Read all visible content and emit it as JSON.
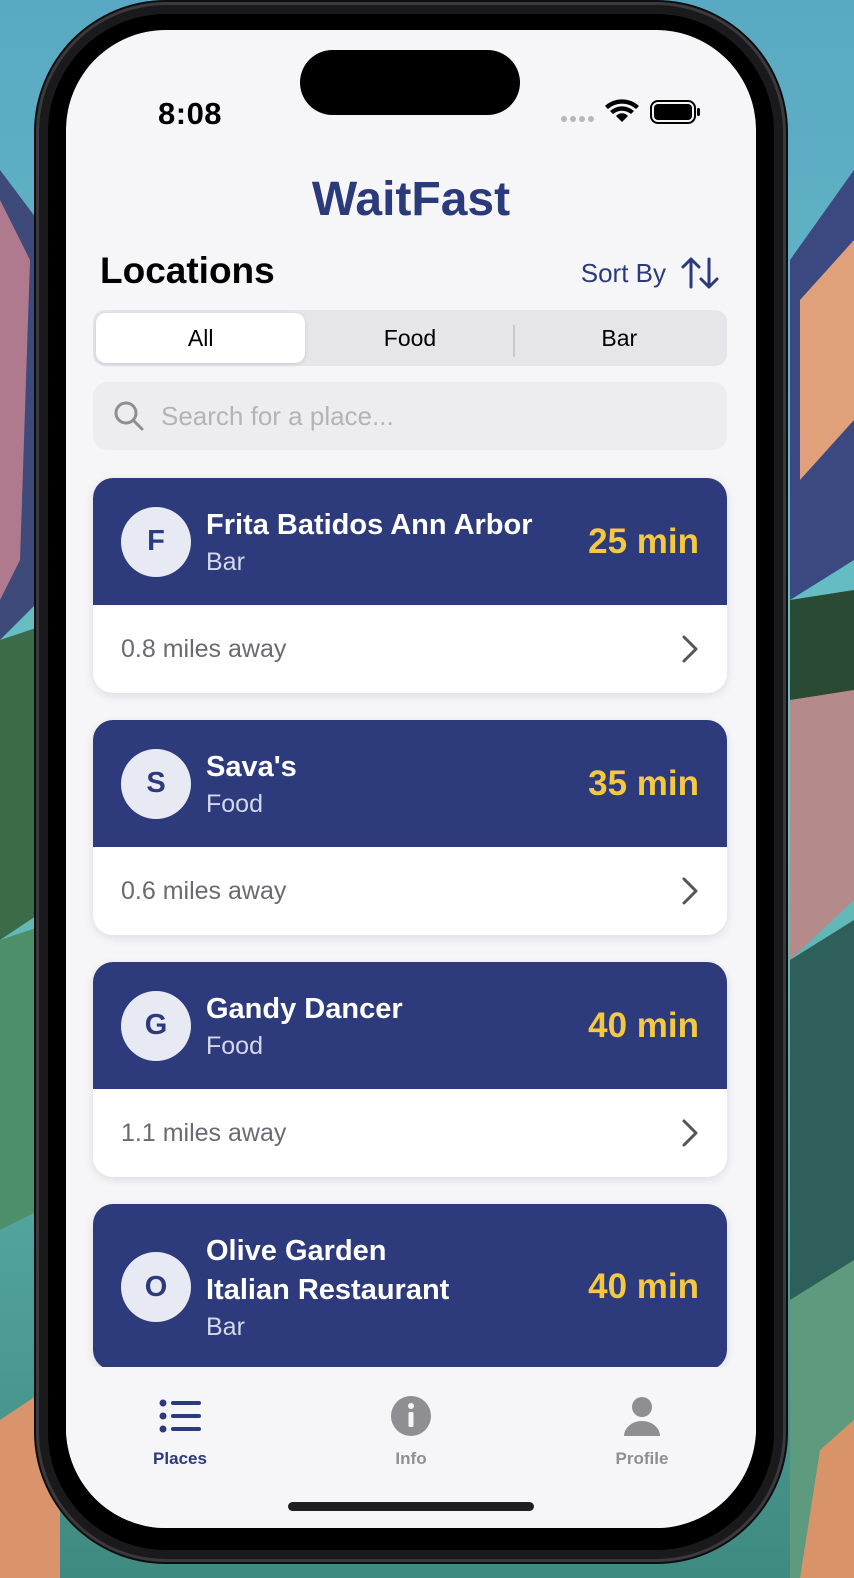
{
  "colors": {
    "brand": "#2b3a7a",
    "card_header": "#2d3a7b",
    "wait_time": "#f5c842",
    "background": "#f6f6f9"
  },
  "status_bar": {
    "time": "8:08",
    "icons": [
      "cellular-dots-icon",
      "wifi-icon",
      "battery-icon"
    ]
  },
  "app": {
    "title": "WaitFast"
  },
  "header": {
    "section_title": "Locations",
    "sort_label": "Sort By",
    "sort_icon": "sort-arrows-icon"
  },
  "filters": {
    "selected": "All",
    "options": [
      "All",
      "Food",
      "Bar"
    ]
  },
  "search": {
    "placeholder": "Search for a place...",
    "value": "",
    "icon": "search-icon"
  },
  "locations": [
    {
      "initial": "F",
      "name": "Frita Batidos Ann Arbor",
      "category": "Bar",
      "wait": "25 min",
      "distance": "0.8 miles away"
    },
    {
      "initial": "S",
      "name": "Sava's",
      "category": "Food",
      "wait": "35 min",
      "distance": "0.6 miles away"
    },
    {
      "initial": "G",
      "name": "Gandy Dancer",
      "category": "Food",
      "wait": "40 min",
      "distance": "1.1 miles away"
    },
    {
      "initial": "O",
      "name": "Olive Garden\nItalian Restaurant",
      "category": "Bar",
      "wait": "40 min",
      "distance": ""
    }
  ],
  "tabs": [
    {
      "label": "Places",
      "icon": "list-icon",
      "active": true
    },
    {
      "label": "Info",
      "icon": "info-icon",
      "active": false
    },
    {
      "label": "Profile",
      "icon": "person-icon",
      "active": false
    }
  ]
}
